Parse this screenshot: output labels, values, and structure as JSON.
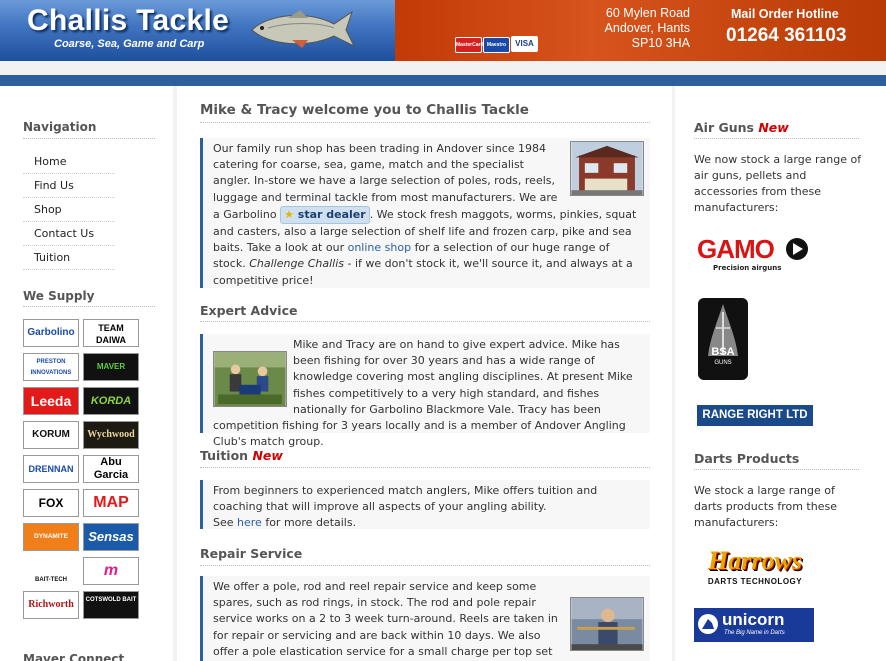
{
  "header": {
    "title": "Challis Tackle",
    "subtitle": "Coarse, Sea, Game and Carp",
    "address": [
      "60 Mylen Road",
      "Andover, Hants",
      "SP10 3HA"
    ],
    "hotline_label": "Mail Order Hotline",
    "hotline_number": "01264 361103",
    "cards": [
      "MasterCard",
      "Maestro",
      "VISA"
    ]
  },
  "nav": {
    "title": "Navigation",
    "items": [
      "Home",
      "Find Us",
      "Shop",
      "Contact Us",
      "Tuition"
    ]
  },
  "supply": {
    "title": "We Supply",
    "brands": [
      "Garbolino",
      "TEAM DAIWA",
      "PRESTON INNOVATIONS",
      "MAVER",
      "Leeda",
      "KORDA",
      "KORUM",
      "Wychwood",
      "DRENNAN",
      "Abu Garcia",
      "FOX",
      "MAP",
      "DYNAMITE BAITS",
      "Sensas",
      "BAIT-TECH",
      "m",
      "Richworth",
      "COTSWOLD BAIT"
    ],
    "footer_title": "Maver Connect"
  },
  "main": {
    "welcome_title": "Mike & Tracy welcome you to Challis Tackle",
    "welcome": {
      "p1": "Our family run shop has been trading in Andover since 1984 catering for coarse, sea, game, match and the specialist angler. In-store we have a large selection of poles, rods, reels, luggage and terminal tackle from most manufacturers. We are a Garbolino",
      "badge": "star dealer",
      "p2": ". We stock fresh maggots, worms, pinkies, squat and casters, also a large selection of shelf life and frozen carp, pike and sea baits. Take a look at our",
      "link": "online shop",
      "p3": "for a selection of our huge range of stock.",
      "em": "Challenge Challis",
      "p4": "- if we don't stock it, we'll source it, and always at a competitive price!"
    },
    "expert_title": "Expert Advice",
    "expert_text": "Mike and Tracy are on hand to give expert advice. Mike has been fishing for over 30 years and has a wide range of knowledge covering most angling disciplines. At present Mike fishes competitively to a very high standard, and fishes nationally for Garbolino Blackmore Vale. Tracy has been competition fishing for 3 years locally and is a member of Andover Angling Club's match group.",
    "tuition_title": "Tuition",
    "tuition_new": "New",
    "tuition_text": "From beginners to experienced match anglers, Mike offers tuition and coaching that will improve all aspects of your angling ability.",
    "tuition_see": "See",
    "tuition_link": "here",
    "tuition_more": "for more details.",
    "repair_title": "Repair Service",
    "repair_text": "We offer a pole, rod and reel repair service and keep some spares, such as rod rings, in stock. The rod and pole repair service works on a 2 to 3 week turn-around. Reels are taken in for repair or servicing and are back within 10 days. We also offer a pole elastication service for a small charge per top set using"
  },
  "right": {
    "airguns_title": "Air Guns",
    "airguns_new": "New",
    "airguns_text": "We now stock a large range of air guns, pellets and accessories from these manufacturers:",
    "gamo": "GAMO",
    "gamo_sub": "Precision airguns",
    "bsa": "BSA",
    "bsa_sub": "GUNS",
    "rangeright": "RANGE RIGHT LTD",
    "darts_title": "Darts Products",
    "darts_text": "We stock a large range of darts products from these manufacturers:",
    "harrows": "Harrows",
    "harrows_sub": "DARTS TECHNOLOGY",
    "unicorn": "unicorn",
    "unicorn_sub": "The Big Name in Darts"
  }
}
